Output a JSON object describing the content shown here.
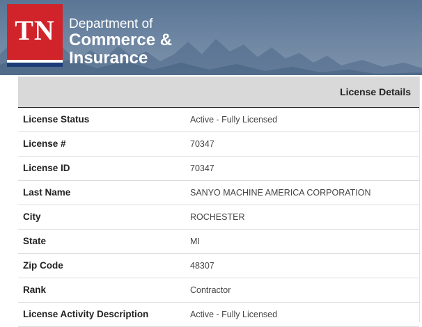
{
  "header": {
    "logo_text": "TN",
    "dept_line1": "Department of",
    "dept_line2": "Commerce &",
    "dept_line3": "Insurance"
  },
  "panel": {
    "title": "License Details",
    "rows": [
      {
        "label": "License Status",
        "value": "Active - Fully Licensed"
      },
      {
        "label": "License #",
        "value": "70347"
      },
      {
        "label": "License ID",
        "value": "70347"
      },
      {
        "label": "Last Name",
        "value": "SANYO MACHINE AMERICA CORPORATION"
      },
      {
        "label": "City",
        "value": "ROCHESTER"
      },
      {
        "label": "State",
        "value": "MI"
      },
      {
        "label": "Zip Code",
        "value": "48307"
      },
      {
        "label": "Rank",
        "value": "Contractor"
      },
      {
        "label": "License Activity Description",
        "value": "Active - Fully Licensed"
      }
    ]
  },
  "colors": {
    "logo_red": "#d1232a",
    "logo_blue": "#1d3b78",
    "banner_blue": "#5a7595",
    "header_gray": "#d9d9d9"
  }
}
